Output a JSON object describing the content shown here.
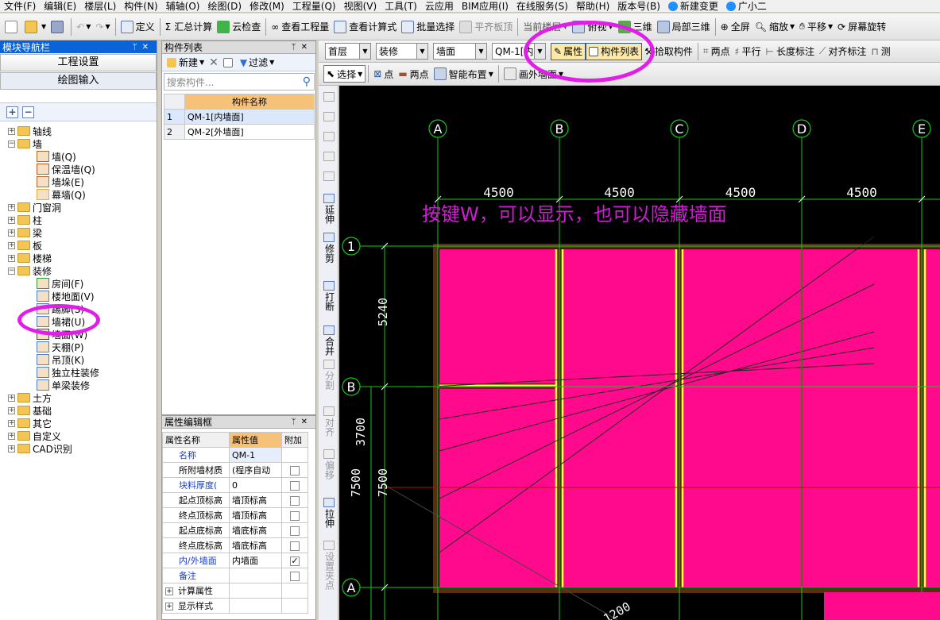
{
  "menubar": {
    "items": [
      "文件(F)",
      "编辑(E)",
      "楼层(L)",
      "构件(N)",
      "辅轴(O)",
      "绘图(D)",
      "修改(M)",
      "工程量(Q)",
      "视图(V)",
      "工具(T)",
      "云应用",
      "BIM应用(I)",
      "在线服务(S)",
      "帮助(H)",
      "版本号(B)",
      "新建变更",
      "广小二"
    ]
  },
  "toolbar1": {
    "define": "定义",
    "sum": "汇总计算",
    "cloud_check": "云检查",
    "view_quantities": "查看工程量",
    "view_formula": "查看计算式",
    "batch_select": "批量选择",
    "align_slab": "平齐板顶",
    "current_layer": "当前楼层",
    "top_view": "俯视",
    "three_d": "三维",
    "partial_3d": "局部三维",
    "full_screen": "全屏",
    "zoom": "缩放",
    "pan": "平移",
    "screen_rotate": "屏幕旋转"
  },
  "nav": {
    "title": "模块导航栏",
    "project_settings": "工程设置",
    "drawing_input": "绘图输入",
    "tree": [
      {
        "label": "轴线",
        "type": "folder",
        "level": 0,
        "expanded": false
      },
      {
        "label": "墙",
        "type": "folder",
        "level": 0,
        "expanded": true
      },
      {
        "label": "墙(Q)",
        "type": "leaf",
        "level": 1
      },
      {
        "label": "保温墙(Q)",
        "type": "leaf",
        "level": 1
      },
      {
        "label": "墙垛(E)",
        "type": "leaf",
        "level": 1
      },
      {
        "label": "幕墙(Q)",
        "type": "leaf",
        "level": 1
      },
      {
        "label": "门窗洞",
        "type": "folder",
        "level": 0,
        "expanded": false
      },
      {
        "label": "柱",
        "type": "folder",
        "level": 0,
        "expanded": false
      },
      {
        "label": "梁",
        "type": "folder",
        "level": 0,
        "expanded": false
      },
      {
        "label": "板",
        "type": "folder",
        "level": 0,
        "expanded": false
      },
      {
        "label": "楼梯",
        "type": "folder",
        "level": 0,
        "expanded": false
      },
      {
        "label": "装修",
        "type": "folder",
        "level": 0,
        "expanded": true
      },
      {
        "label": "房间(F)",
        "type": "leaf",
        "level": 1
      },
      {
        "label": "楼地面(V)",
        "type": "leaf",
        "level": 1
      },
      {
        "label": "踢脚(S)",
        "type": "leaf",
        "level": 1
      },
      {
        "label": "墙裙(U)",
        "type": "leaf",
        "level": 1
      },
      {
        "label": "墙面(W)",
        "type": "leaf",
        "level": 1
      },
      {
        "label": "天棚(P)",
        "type": "leaf",
        "level": 1
      },
      {
        "label": "吊顶(K)",
        "type": "leaf",
        "level": 1
      },
      {
        "label": "独立柱装修",
        "type": "leaf",
        "level": 1
      },
      {
        "label": "单梁装修",
        "type": "leaf",
        "level": 1
      },
      {
        "label": "土方",
        "type": "folder",
        "level": 0,
        "expanded": false
      },
      {
        "label": "基础",
        "type": "folder",
        "level": 0,
        "expanded": false
      },
      {
        "label": "其它",
        "type": "folder",
        "level": 0,
        "expanded": false
      },
      {
        "label": "自定义",
        "type": "folder",
        "level": 0,
        "expanded": false
      },
      {
        "label": "CAD识别",
        "type": "folder",
        "level": 0,
        "expanded": false
      }
    ]
  },
  "component_list": {
    "title": "构件列表",
    "new_label": "新建",
    "filter_label": "过滤",
    "search_placeholder": "搜索构件...",
    "column_header": "构件名称",
    "rows": [
      {
        "num": "1",
        "name": "QM-1[内墙面]"
      },
      {
        "num": "2",
        "name": "QM-2[外墙面]"
      }
    ]
  },
  "property_editor": {
    "title": "属性编辑框",
    "headers": {
      "name": "属性名称",
      "value": "属性值",
      "extra": "附加"
    },
    "rows": [
      {
        "name": "名称",
        "value": "QM-1",
        "blue": true,
        "checkbox": false,
        "checked": false
      },
      {
        "name": "所附墙材质",
        "value": "(程序自动",
        "blue": false,
        "checkbox": true,
        "checked": false
      },
      {
        "name": "块料厚度(",
        "value": "0",
        "blue": true,
        "checkbox": true,
        "checked": false
      },
      {
        "name": "起点顶标高",
        "value": "墙顶标高",
        "blue": false,
        "checkbox": true,
        "checked": false
      },
      {
        "name": "终点顶标高",
        "value": "墙顶标高",
        "blue": false,
        "checkbox": true,
        "checked": false
      },
      {
        "name": "起点底标高",
        "value": "墙底标高",
        "blue": false,
        "checkbox": true,
        "checked": false
      },
      {
        "name": "终点底标高",
        "value": "墙底标高",
        "blue": false,
        "checkbox": true,
        "checked": false
      },
      {
        "name": "内/外墙面",
        "value": "内墙面",
        "blue": true,
        "checkbox": true,
        "checked": true
      },
      {
        "name": "备注",
        "value": "",
        "blue": true,
        "checkbox": true,
        "checked": false
      }
    ],
    "groups": [
      "计算属性",
      "显示样式"
    ]
  },
  "toolbar2": {
    "floor": "首层",
    "category": "装修",
    "component_type": "墙面",
    "component": "QM-1[内",
    "attributes": "属性",
    "component_list": "构件列表",
    "pick_component": "拾取构件",
    "two_points": "两点",
    "parallel": "平行",
    "length_dim": "长度标注",
    "aligned_dim": "对齐标注",
    "measure": "测"
  },
  "toolbar3": {
    "select": "选择",
    "point": "点",
    "two_points": "两点",
    "smart_layout": "智能布置",
    "draw_outer_wall": "画外墙面"
  },
  "side_tools": [
    "延伸",
    "修剪",
    "打断",
    "合并",
    "分割",
    "对齐",
    "偏移",
    "拉伸",
    "设置夹点"
  ],
  "canvas": {
    "annotation": "按键W，可以显示，也可以隐藏墙面",
    "axes_x": [
      "A",
      "B",
      "C",
      "D",
      "E"
    ],
    "axes_y": [
      "1",
      "B",
      "A"
    ],
    "dims_x": [
      "4500",
      "4500",
      "4500",
      "4500"
    ],
    "dims_y_outer": "5240",
    "dims_y_mid": "3700",
    "dims_y_total_a": "7500",
    "dims_y_total_b": "7500",
    "dim_bottom": "1200"
  },
  "colors": {
    "wall_face": "#ff0a8c",
    "wall_edge": "#ffff33",
    "highlight": "#e11ee8",
    "axis": "#18c51a",
    "annotation": "#d21bd6"
  }
}
